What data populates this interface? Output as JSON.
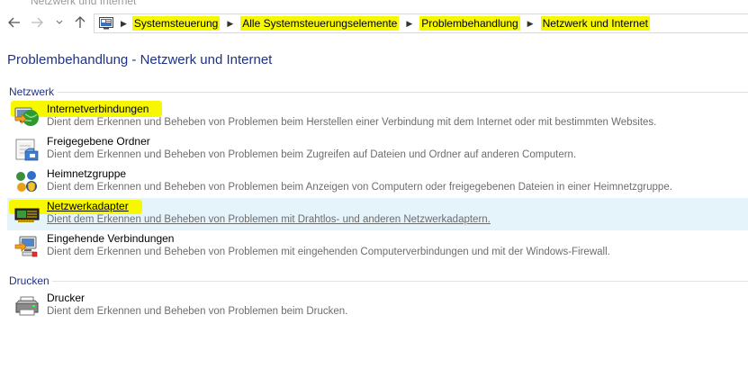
{
  "window": {
    "title": "Netzwerk und Internet"
  },
  "breadcrumb": [
    "Systemsteuerung",
    "Alle Systemsteuerungselemente",
    "Problembehandlung",
    "Netzwerk und Internet"
  ],
  "page": {
    "title": "Problembehandlung - Netzwerk und Internet"
  },
  "groups": [
    {
      "header": "Netzwerk",
      "items": [
        {
          "name": "Internetverbindungen",
          "description": "Dient dem Erkennen und Beheben von Problemen beim Herstellen einer Verbindung mit dem Internet oder mit bestimmten Websites.",
          "icon": "internet-connections-icon"
        },
        {
          "name": "Freigegebene Ordner",
          "description": "Dient dem Erkennen und Beheben von Problemen beim Zugreifen auf Dateien und Ordner auf anderen Computern.",
          "icon": "shared-folders-icon"
        },
        {
          "name": "Heimnetzgruppe",
          "description": "Dient dem Erkennen und Beheben von Problemen beim Anzeigen von Computern oder freigegebenen Dateien in einer Heimnetzgruppe.",
          "icon": "homegroup-icon"
        },
        {
          "name": "Netzwerkadapter",
          "description": "Dient dem Erkennen und Beheben von Problemen mit Drahtlos- und anderen Netzwerkadaptern.",
          "icon": "network-adapter-icon"
        },
        {
          "name": "Eingehende Verbindungen",
          "description": "Dient dem Erkennen und Beheben von Problemen mit eingehenden Computerverbindungen und mit der Windows-Firewall.",
          "icon": "incoming-connections-icon"
        }
      ]
    },
    {
      "header": "Drucken",
      "items": [
        {
          "name": "Drucker",
          "description": "Dient dem Erkennen und Beheben von Problemen beim Drucken.",
          "icon": "printer-icon"
        }
      ]
    }
  ],
  "colors": {
    "header_blue": "#1e3287",
    "hover_bg": "#e5f3fb",
    "highlight": "#f7f700"
  }
}
